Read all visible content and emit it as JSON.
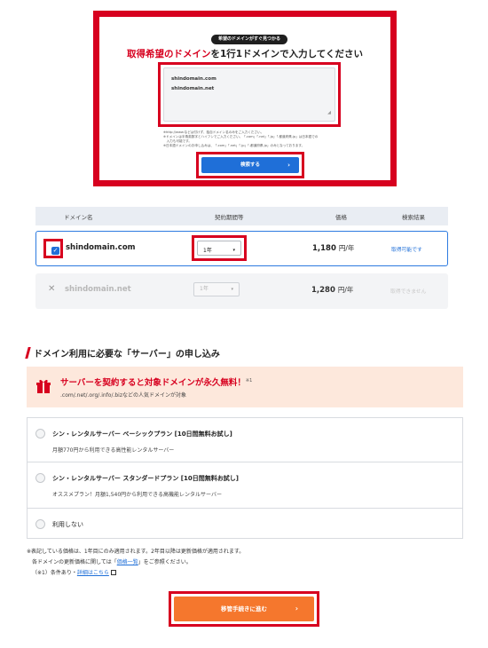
{
  "search": {
    "pill": "希望のドメインがすぐ見つかる",
    "title_prefix": "取得希望の",
    "title_highlight": "ドメイン",
    "title_suffix": "を1行1ドメインで入力してください",
    "domains": [
      "shindomain.com",
      "shindomain.net"
    ],
    "notes": [
      "※http://www.などは付けず、独自ドメイン名のみをご入力ください。",
      "※ドメインは半角英数字とハイフンでご入力ください。「.com」「.net」「.jp」「.都道府県.jp」は日本語での",
      "　入力も可能です。",
      "※日本語ドメインのお申し込みは、「.com」「.net」「.jp」「.都道府県.jp」のみとなっております。"
    ],
    "button_label": "検索する",
    "button_chevron": "›"
  },
  "table": {
    "headers": {
      "domain": "ドメイン名",
      "period": "契約期間等",
      "price": "価格",
      "result": "検索結果"
    },
    "rows": [
      {
        "domain": "shindomain.com",
        "period": "1年",
        "price": "1,180",
        "unit": "円/年",
        "status": "取得可能です",
        "check": "✓"
      },
      {
        "domain": "shindomain.net",
        "period": "1年",
        "price": "1,280",
        "unit": "円/年",
        "status": "取得できません",
        "mark": "✕"
      }
    ],
    "select_arrow": "▾"
  },
  "server": {
    "section_title": "ドメイン利用に必要な「サーバー」の申し込み",
    "promo_title": "サーバーを契約すると対象ドメインが永久無料！",
    "promo_note_mark": "※1",
    "promo_sub": ".com/.net/.org/.info/.bizなどの人気ドメインが対象",
    "plans": [
      {
        "name": "シン・レンタルサーバー ベーシックプラン [10日間無料お試し]",
        "desc": "月額770円から利用できる高性能レンタルサーバー"
      },
      {
        "name": "シン・レンタルサーバー スタンダードプラン [10日間無料お試し]",
        "desc": "オススメプラン！月額1,540円から利用できる高機能レンタルサーバー"
      }
    ],
    "none_label": "利用しない"
  },
  "footnotes": {
    "line1": "※表記している価格は、1年目にのみ適用されます。2年目以降は更新価格が適用されます。",
    "line2_prefix": "各ドメインの更新価格に関しては「",
    "line2_link": "価格一覧",
    "line2_suffix": "」をご参照ください。",
    "line3_prefix": "（※1）条件あり・",
    "line3_link": "詳細はこちら"
  },
  "proceed": {
    "label": "移管手続きに進む",
    "chevron": "›"
  },
  "colors": {
    "accent_red": "#d7001f",
    "primary_blue": "#1f6fd8",
    "cta_orange": "#f5772d",
    "promo_bg": "#fde8dc"
  }
}
